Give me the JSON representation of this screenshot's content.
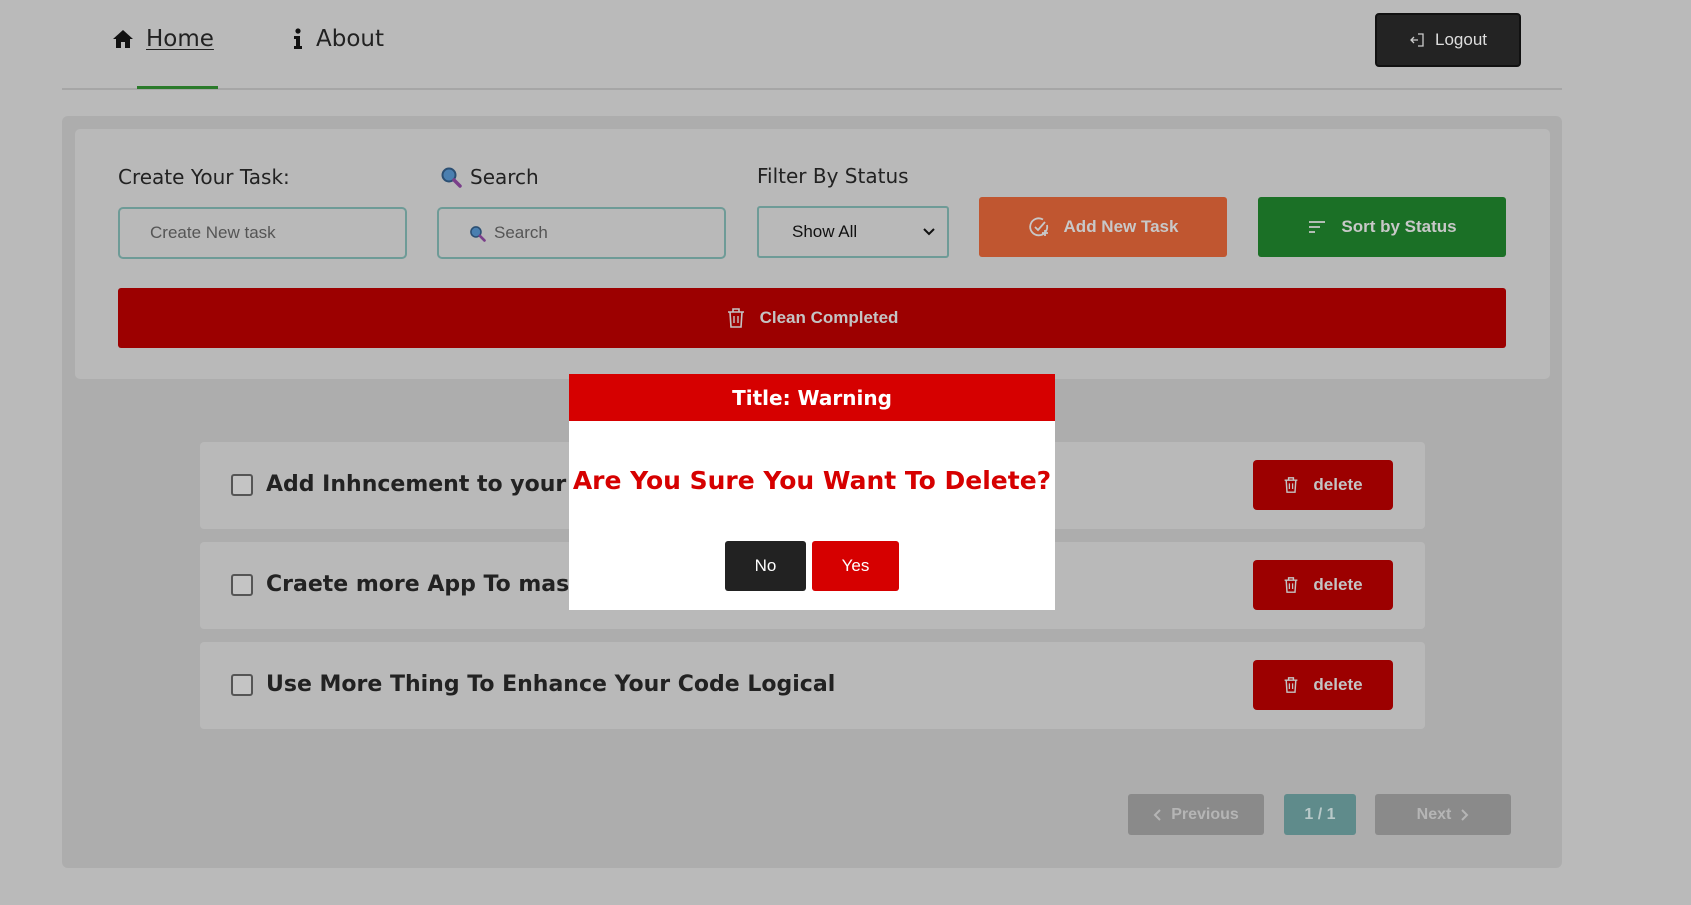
{
  "nav": {
    "home_label": "Home",
    "about_label": "About",
    "logout_label": "Logout",
    "icons": {
      "home": "home-icon",
      "about": "info-icon",
      "logout": "logout-icon"
    }
  },
  "form": {
    "create_label": "Create Your Task:",
    "create_placeholder": "Create New task",
    "search_label": "Search",
    "search_placeholder": "Search",
    "filter_label": "Filter By Status",
    "filter_value": "Show All",
    "add_button": "Add New Task",
    "sort_button": "Sort by Status",
    "clean_button": "Clean Completed"
  },
  "tasks": [
    {
      "title": "Add Inhncement to your App",
      "completed": false,
      "delete_label": "delete"
    },
    {
      "title": "Craete more App To master Th",
      "completed": false,
      "delete_label": "delete"
    },
    {
      "title": "Use More Thing To Enhance Your Code Logical",
      "completed": false,
      "delete_label": "delete"
    }
  ],
  "pagination": {
    "previous_label": "Previous",
    "page_indicator": "1 / 1",
    "next_label": "Next"
  },
  "modal": {
    "title": "Title: Warning",
    "message": "Are You Sure You Want To Delete?",
    "no_label": "No",
    "yes_label": "Yes"
  },
  "colors": {
    "accent_green": "#1b7026",
    "add_orange": "#c05630",
    "danger_red": "#9c0000",
    "modal_red": "#d60000"
  }
}
